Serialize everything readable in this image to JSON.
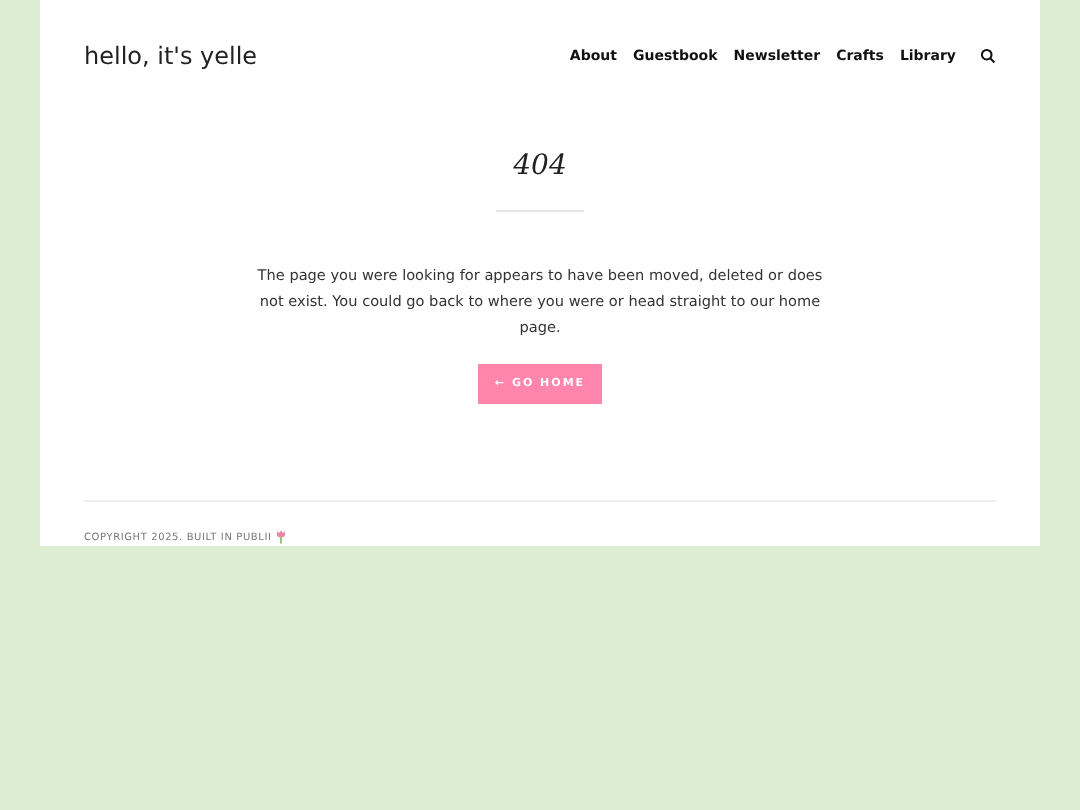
{
  "site_title": "hello, it's yelle",
  "nav": [
    "About",
    "Guestbook",
    "Newsletter",
    "Crafts",
    "Library"
  ],
  "heading": "404",
  "message": "The page you were looking for appears to have been moved, deleted or does not exist. You could go back to where you were or head straight to our home page.",
  "button": "← GO HOME",
  "footer": "COPYRIGHT 2025. BUILT IN PUBLII"
}
